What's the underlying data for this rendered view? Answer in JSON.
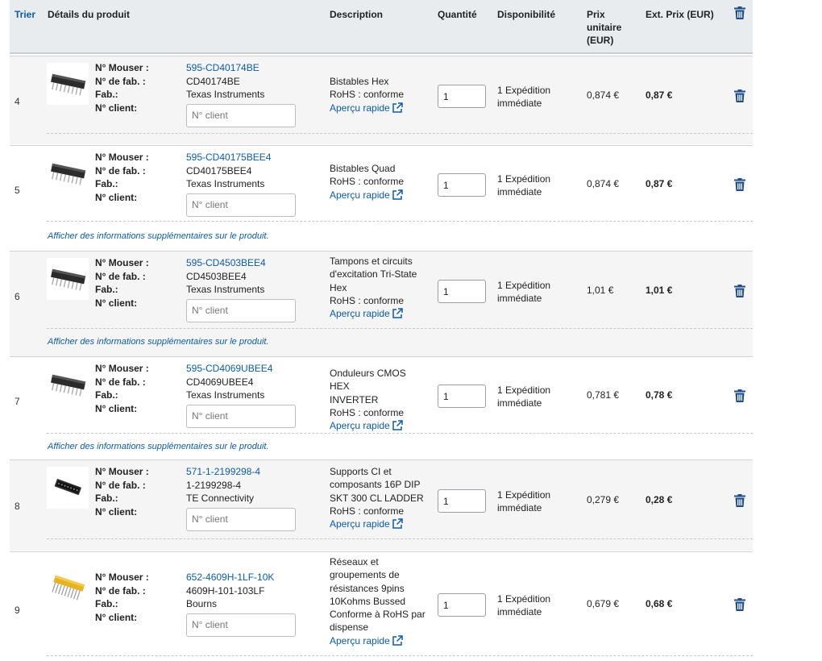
{
  "header": {
    "sort": "Trier",
    "details": "Détails du produit",
    "description": "Description",
    "quantity": "Quantité",
    "availability": "Disponibilité",
    "unit_price": "Prix unitaire (EUR)",
    "ext_price": "Ext. Prix (EUR)"
  },
  "labels": {
    "mouser": "N° Mouser :",
    "mfr_part": "N° de fab. :",
    "mfr": "Fab.:",
    "client": "N° client:",
    "client_placeholder": "N° client",
    "quick_view": "Aperçu rapide",
    "more_info": "Afficher des informations supplémentaires sur le produit."
  },
  "icons": {
    "trash": "trash-icon",
    "external_link": "external-link-icon"
  },
  "colors": {
    "link": "#0b5cab",
    "trash": "#1d4e89",
    "header_bg": "#e9ecef"
  },
  "rows": [
    {
      "num": "4",
      "mouser": "595-CD40174BE",
      "mfr_part": "CD40174BE",
      "mfr": "Texas Instruments",
      "desc": [
        "Bistables Hex"
      ],
      "rohs": "RoHS : conforme",
      "qty": "1",
      "availability": [
        "1 Expédition",
        "immédiate"
      ],
      "unit_price": "0,874 €",
      "ext_price": "0,87 €",
      "more_info": false
    },
    {
      "num": "5",
      "mouser": "595-CD40175BEE4",
      "mfr_part": "CD40175BEE4",
      "mfr": "Texas Instruments",
      "desc": [
        "Bistables Quad"
      ],
      "rohs": "RoHS : conforme",
      "qty": "1",
      "availability": [
        "1 Expédition",
        "immédiate"
      ],
      "unit_price": "0,874 €",
      "ext_price": "0,87 €",
      "more_info": true
    },
    {
      "num": "6",
      "mouser": "595-CD4503BEE4",
      "mfr_part": "CD4503BEE4",
      "mfr": "Texas Instruments",
      "desc": [
        "Tampons et circuits",
        "d'excitation Tri-State",
        "Hex"
      ],
      "rohs": "RoHS : conforme",
      "qty": "1",
      "availability": [
        "1 Expédition",
        "immédiate"
      ],
      "unit_price": "1,01 €",
      "ext_price": "1,01 €",
      "more_info": true
    },
    {
      "num": "7",
      "mouser": "595-CD4069UBEE4",
      "mfr_part": "CD4069UBEE4",
      "mfr": "Texas Instruments",
      "desc": [
        "Onduleurs CMOS HEX",
        "INVERTER"
      ],
      "rohs": "RoHS : conforme",
      "qty": "1",
      "availability": [
        "1 Expédition",
        "immédiate"
      ],
      "unit_price": "0,781 €",
      "ext_price": "0,78 €",
      "more_info": true
    },
    {
      "num": "8",
      "mouser": "571-1-2199298-4",
      "mfr_part": "1-2199298-4",
      "mfr": "TE Connectivity",
      "desc": [
        "Supports CI et",
        "composants 16P DIP",
        "SKT 300 CL LADDER"
      ],
      "rohs": "RoHS : conforme",
      "qty": "1",
      "availability": [
        "1 Expédition",
        "immédiate"
      ],
      "unit_price": "0,279 €",
      "ext_price": "0,28 €",
      "more_info": false
    },
    {
      "num": "9",
      "mouser": "652-4609H-1LF-10K",
      "mfr_part": "4609H-101-103LF",
      "mfr": "Bourns",
      "desc": [
        "Réseaux et",
        "groupements de",
        "résistances 9pins",
        "10Kohms Bussed"
      ],
      "rohs": "Conforme à RoHS par dispense",
      "qty": "1",
      "availability": [
        "1 Expédition",
        "immédiate"
      ],
      "unit_price": "0,679 €",
      "ext_price": "0,68 €",
      "more_info": false
    }
  ]
}
